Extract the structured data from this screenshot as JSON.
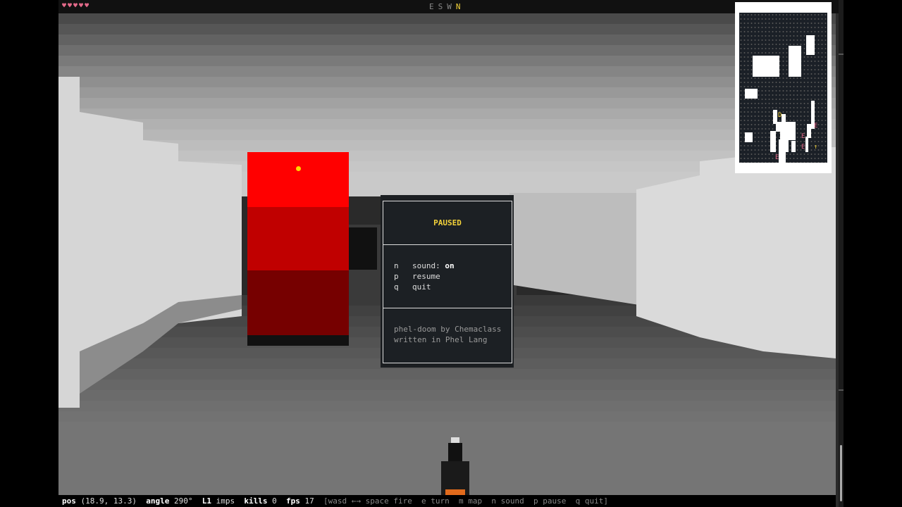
{
  "hud": {
    "hearts": "♥♥♥♥♥",
    "compass": {
      "e": "E",
      "s": "S",
      "w": "W",
      "n": "N"
    }
  },
  "pause_menu": {
    "title": "PAUSED",
    "items": [
      {
        "key": "n",
        "label": "sound: ",
        "value": "on"
      },
      {
        "key": "p",
        "label": "resume"
      },
      {
        "key": "q",
        "label": "quit"
      }
    ],
    "credit_line1": "phel-doom by Chemaclass",
    "credit_line2": "written in Phel Lang"
  },
  "minimap": {
    "door_marker": "D",
    "enemy_marker": "E",
    "player_marker": "↑"
  },
  "status": {
    "pos_label": "pos",
    "pos_value": "(18.9, 13.3)",
    "angle_label": "angle",
    "angle_value": "290°",
    "level_label": "L1",
    "level_value": "imps",
    "kills_label": "kills",
    "kills_value": "0",
    "fps_label": "fps",
    "fps_value": "17",
    "help": "[wasd ←→ space fire  e turn  m map  n sound  p pause  q quit]"
  },
  "colors": {
    "enemy_bright": "#ff0000",
    "accent_yellow": "#f4d33a",
    "heart_pink": "#e46a8a",
    "gun_orange": "#e06a1c"
  }
}
